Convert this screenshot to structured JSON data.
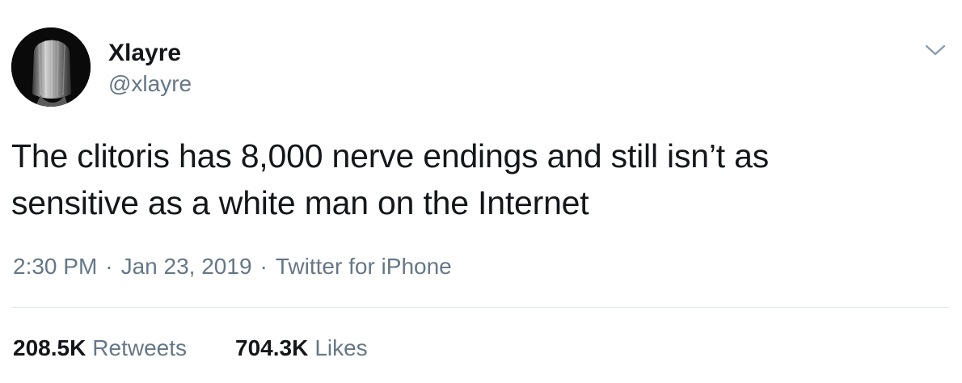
{
  "author": {
    "display_name": "Xlayre",
    "handle": "@xlayre",
    "avatar_icon": "profile-photo"
  },
  "menu": {
    "icon": "chevron-down-icon"
  },
  "tweet": {
    "text_lines": [
      "The clitoris has 8,000 nerve endings and still isn’t as",
      "sensitive as a white man on the Internet"
    ],
    "time": "2:30 PM",
    "separator": "·",
    "date": "Jan 23, 2019",
    "source": "Twitter for iPhone"
  },
  "stats": {
    "retweets_count": "208.5K",
    "retweets_label": "Retweets",
    "likes_count": "704.3K",
    "likes_label": "Likes"
  },
  "colors": {
    "primary_text": "#14171a",
    "secondary_text": "#657786",
    "divider": "#e1e8ed"
  }
}
